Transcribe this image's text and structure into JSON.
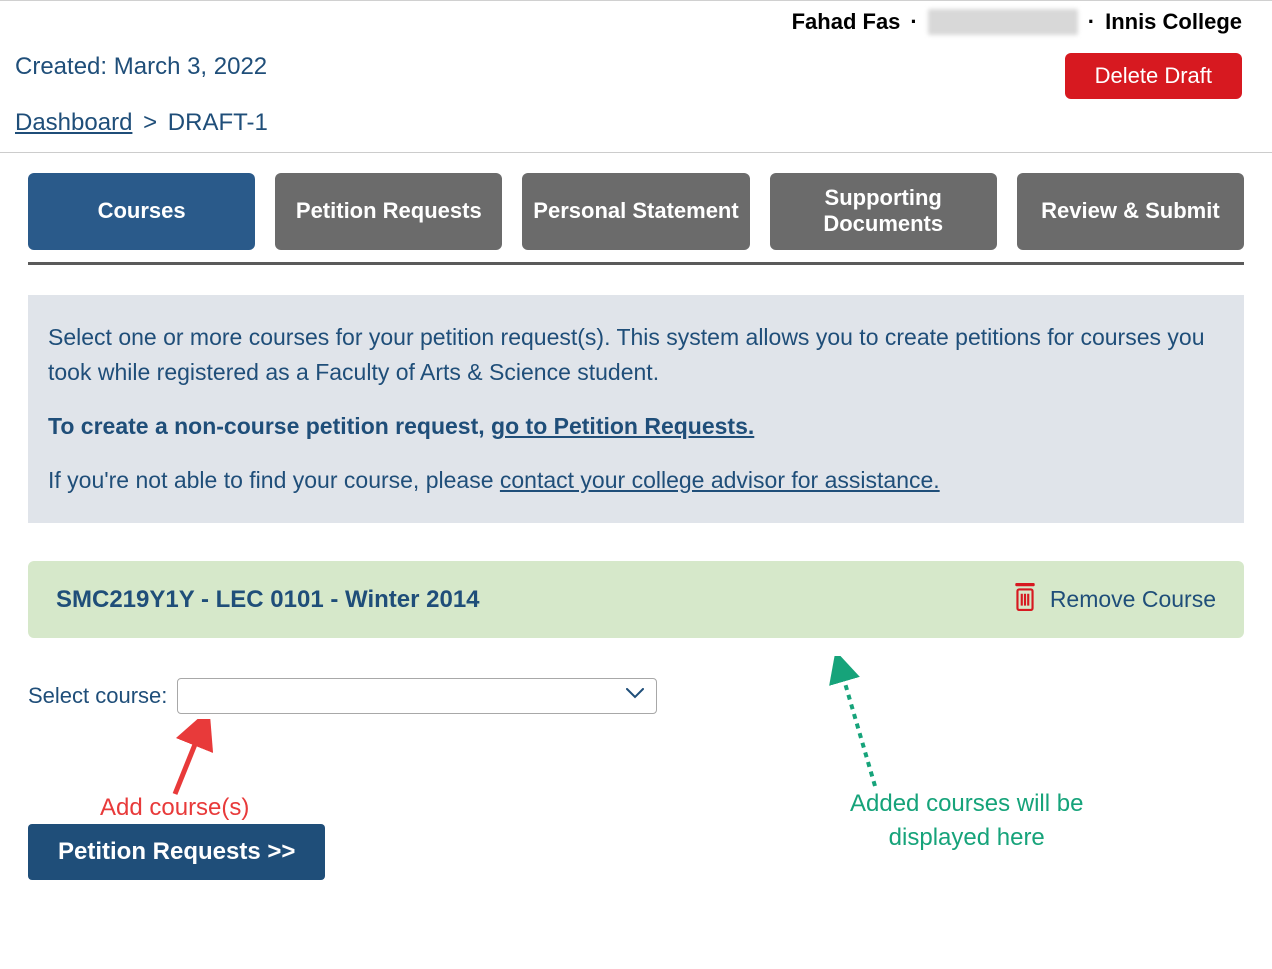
{
  "header": {
    "user_name": "Fahad Fas",
    "college": "Innis College"
  },
  "meta": {
    "created_label": "Created:",
    "created_date": "March 3, 2022",
    "delete_label": "Delete Draft"
  },
  "breadcrumb": {
    "dashboard_label": "Dashboard",
    "separator": ">",
    "current": "DRAFT-1"
  },
  "tabs": {
    "courses": "Courses",
    "petition": "Petition Requests",
    "statement": "Personal Statement",
    "documents": "Supporting Documents",
    "review": "Review & Submit"
  },
  "info": {
    "line1": "Select one or more courses for your petition request(s). This system allows you to create petitions for courses you took while registered as a Faculty of Arts & Science student.",
    "line2a": "To create a non-course petition request, ",
    "line2b": "go to Petition Requests.",
    "line3a": "If you're not able to find your course, please ",
    "line3b": "contact your college advisor for assistance."
  },
  "course": {
    "title": "SMC219Y1Y - LEC 0101 - Winter 2014",
    "remove_label": "Remove Course"
  },
  "select": {
    "label": "Select course:"
  },
  "annotations": {
    "add_courses": "Add course(s)",
    "added_display_line1": "Added courses will be",
    "added_display_line2": "displayed here"
  },
  "next_button": "Petition Requests >>"
}
